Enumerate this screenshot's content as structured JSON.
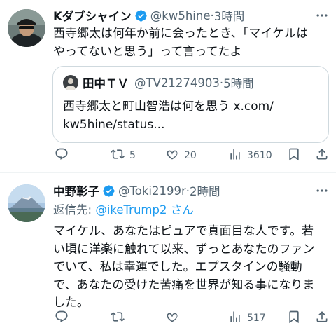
{
  "tweets": [
    {
      "display_name": "Kダブシャイン",
      "handle": "@kw5hine",
      "separator": "·",
      "time": "3時間",
      "text_lines": [
        "西寺郷太は何年か前に会ったとき、「マイケルは",
        "やってないと思う」って言ってたよ"
      ],
      "quote": {
        "display_name": "田中ＴＶ",
        "handle": "@TV21274903",
        "separator": "·",
        "time": "5時間",
        "text_lines": [
          "西寺郷太と町山智浩は何を思う x.com/",
          "kw5hine/status..."
        ]
      },
      "actions": {
        "reply_count": "",
        "retweet_count": "5",
        "like_count": "20",
        "views_count": "3610"
      }
    },
    {
      "display_name": "中野彰子",
      "handle": "@Toki2199r",
      "separator": "·",
      "time": "2時間",
      "reply_to_label": "返信先:",
      "reply_to_mention": "@ikeTrump2",
      "reply_to_suffix": "さん",
      "text_lines": [
        "マイケル、あなたはピュアで真面目な人です。若",
        "い頃に洋楽に触れて以来、ずっとあなたのファン",
        "でいて、私は幸運でした。エプスタインの騒動",
        "で、あなたの受けた苦痛を世界が知る事になりま",
        "した。"
      ],
      "actions": {
        "reply_count": "",
        "retweet_count": "",
        "like_count": "",
        "views_count": "517"
      }
    }
  ],
  "colors": {
    "accent": "#1d9bf0",
    "muted": "#536471",
    "text": "#0f1419",
    "border": "#cfd9de",
    "verified": "#1d9bf0"
  },
  "icons": [
    "reply-icon",
    "retweet-icon",
    "like-icon",
    "views-icon",
    "bookmark-icon",
    "share-icon",
    "more-icon",
    "verified-icon"
  ]
}
